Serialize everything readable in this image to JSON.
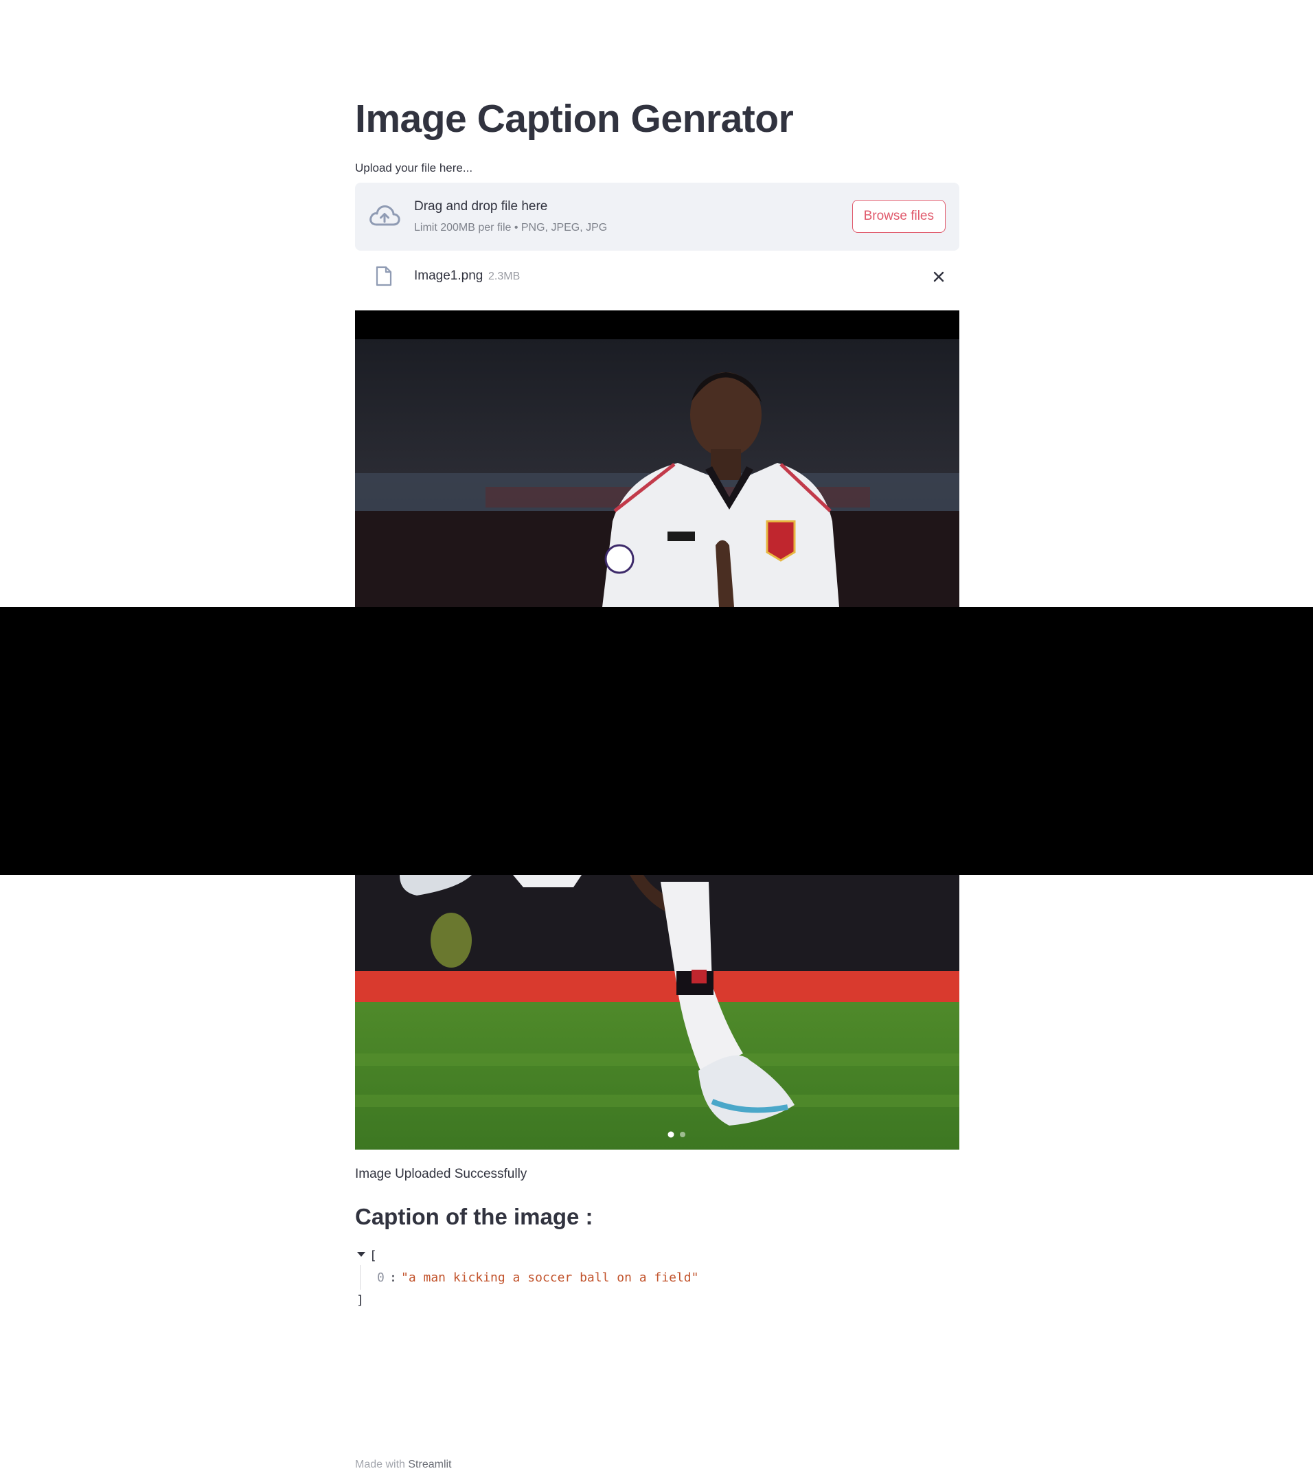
{
  "app": {
    "title": "Image Caption Genrator"
  },
  "uploader": {
    "label": "Upload your file here...",
    "drop_text": "Drag and drop file here",
    "limit_text": "Limit 200MB per file • PNG, JPEG, JPG",
    "browse_label": "Browse files",
    "icon": "cloud-upload-icon"
  },
  "uploaded_file": {
    "name": "Image1.png",
    "size": "2.3MB",
    "icon": "file-icon",
    "remove_icon": "close-icon"
  },
  "image": {
    "alt": "Uploaded photo of a soccer player in a white kit running on a pitch"
  },
  "status": {
    "message": "Image Uploaded Successfully"
  },
  "caption": {
    "heading": "Caption of the image :",
    "json_open": "[",
    "json_close": "]",
    "items": [
      {
        "key": "0",
        "colon": ":",
        "value": "\"a man kicking a soccer ball on a field\""
      }
    ]
  },
  "footer": {
    "prefix": "Made with",
    "link": "Streamlit"
  },
  "colors": {
    "accent": "#e0596b",
    "text": "#31333f",
    "dropzone_bg": "#f0f2f6",
    "json_string": "#c2542d"
  }
}
